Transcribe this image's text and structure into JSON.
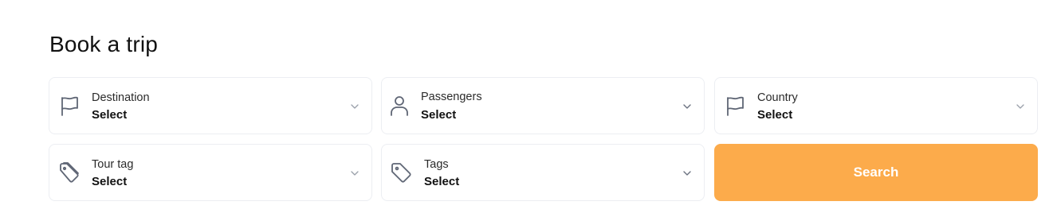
{
  "heading": "Book a trip",
  "fields": {
    "destination": {
      "label": "Destination",
      "value": "Select",
      "icon": "flag-icon"
    },
    "passengers": {
      "label": "Passengers",
      "value": "Select",
      "icon": "user-icon"
    },
    "country": {
      "label": "Country",
      "value": "Select",
      "icon": "flag-icon"
    },
    "tour_tag": {
      "label": "Tour tag",
      "value": "Select",
      "icon": "tags-icon"
    },
    "tags": {
      "label": "Tags",
      "value": "Select",
      "icon": "tag-icon"
    }
  },
  "search": {
    "label": "Search"
  },
  "colors": {
    "accent": "#fcab4b",
    "border": "#eceef2",
    "icon": "#5f6675"
  }
}
